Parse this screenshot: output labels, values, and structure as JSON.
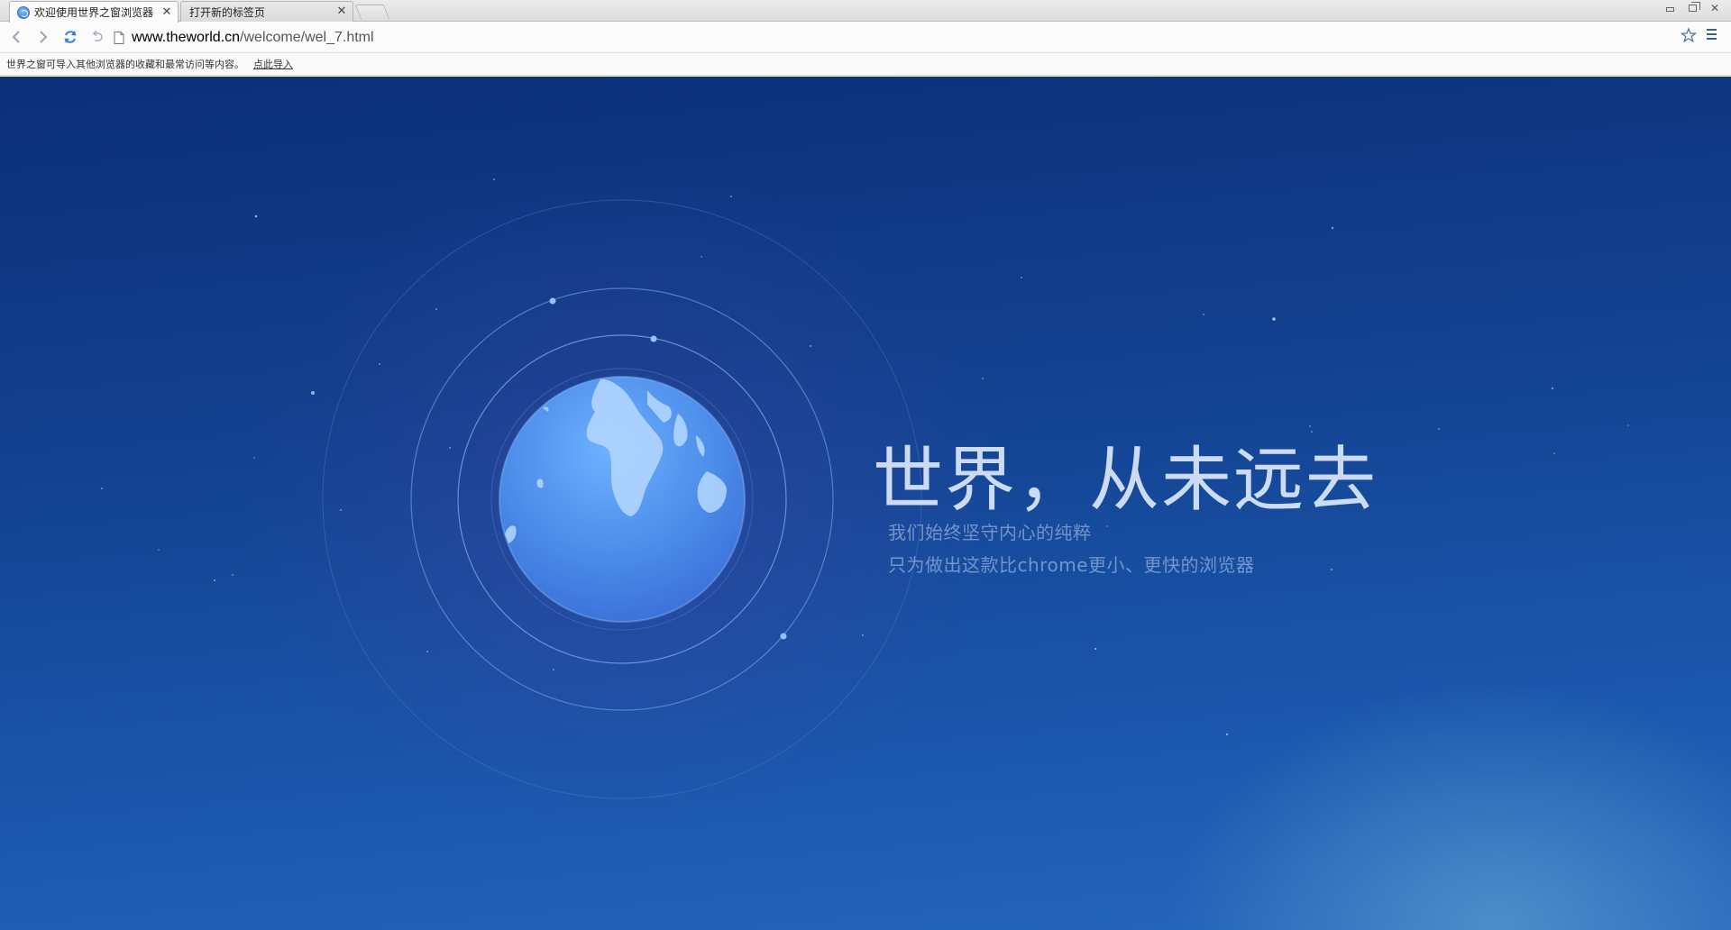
{
  "tabs": [
    {
      "title": "欢迎使用世界之窗浏览器",
      "active": true
    },
    {
      "title": "打开新的标签页",
      "active": false
    }
  ],
  "toolbar": {
    "url_host": "www.theworld.cn",
    "url_path": "/welcome/wel_7.html"
  },
  "infobar": {
    "message": "世界之窗可导入其他浏览器的收藏和最常访问等内容。",
    "link": "点此导入"
  },
  "hero": {
    "headline": "世界，从未远去",
    "subline1": "我们始终坚守内心的纯粹",
    "subline2": "只为做出这款比chrome更小、更快的浏览器"
  },
  "colors": {
    "background_top": "#0c2f78",
    "background_bottom": "#2566bc",
    "globe": "#4a8ae8"
  },
  "icons": {
    "back": "arrow-left-icon",
    "forward": "arrow-right-icon",
    "reload": "reload-icon",
    "undo": "undo-icon",
    "page": "page-icon",
    "bookmark": "star-icon",
    "menu": "menu-icon"
  }
}
